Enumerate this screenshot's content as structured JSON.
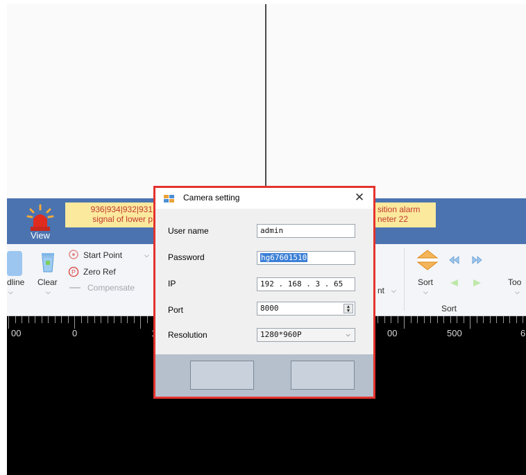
{
  "alarm": {
    "left_line1": "936|934|932|931",
    "left_line2": "signal of lower p",
    "right_line1": "sition alarm",
    "right_line2": "neter 22",
    "view_label": "View"
  },
  "ribbon": {
    "dline_label": "dline",
    "clear_label": "Clear",
    "start_point_label": "Start Point",
    "zero_ref_label": "Zero Ref",
    "compensate_label": "Compensate",
    "nt_label": "nt",
    "sort_label": "Sort",
    "sort_group_label": "Sort",
    "tool_label": "Too"
  },
  "ruler": {
    "labels": [
      "00",
      "0",
      "1",
      "00",
      "500",
      "6"
    ]
  },
  "dialog": {
    "title": "Camera setting",
    "close_glyph": "✕",
    "username_label": "User name",
    "username_value": "admin",
    "password_label": "Password",
    "password_value": "hg67601510",
    "ip_label": "IP",
    "ip_value": "192 . 168 . 3 . 65",
    "port_label": "Port",
    "port_value": "8000",
    "resolution_label": "Resolution",
    "resolution_value": "1280*960P"
  },
  "colors": {
    "dialog_border": "#e5322d",
    "alarm_bar": "#4a73b0",
    "alarm_box": "#fbe99e",
    "selection": "#3b7fd6"
  },
  "icons": [
    "siren-icon",
    "trash-icon",
    "start-point-icon",
    "zero-ref-icon",
    "sort-icon",
    "first-icon",
    "last-icon",
    "prev-icon",
    "next-icon",
    "camera-setting-icon",
    "close-icon",
    "spin-icon",
    "chevron-down-icon"
  ]
}
